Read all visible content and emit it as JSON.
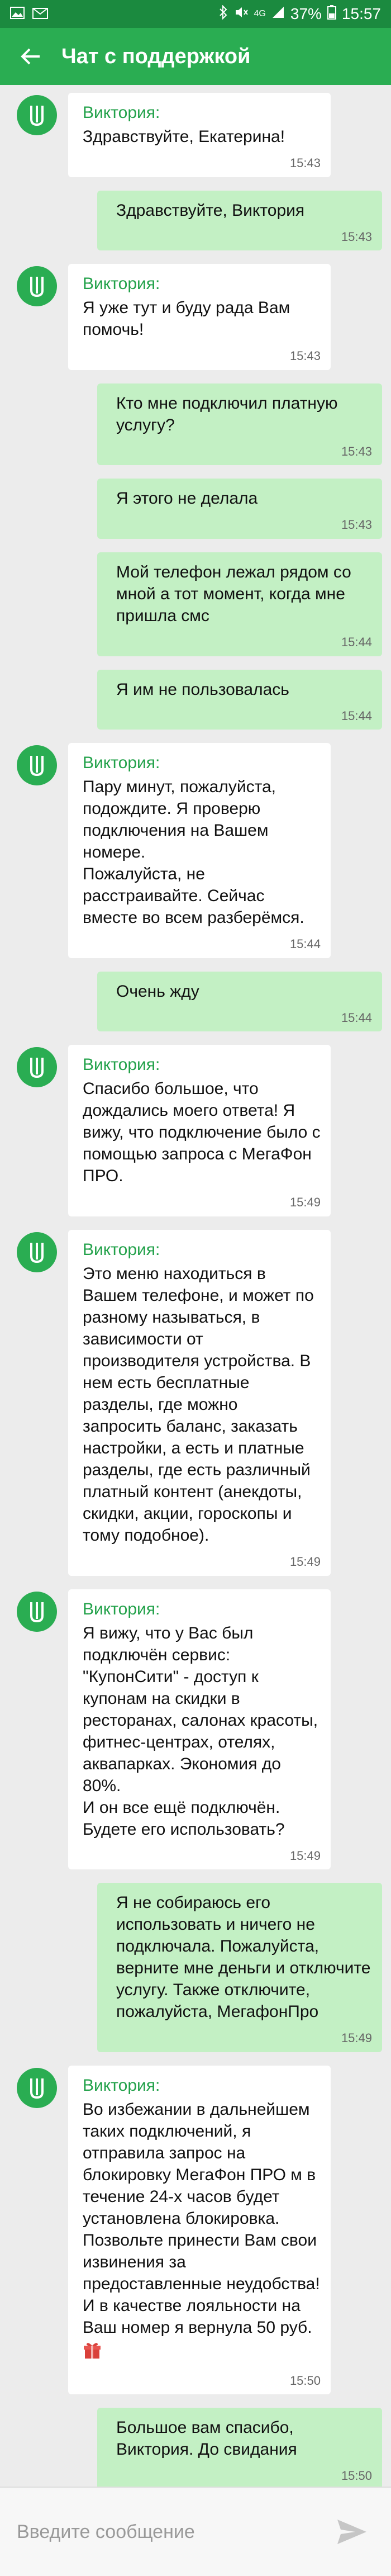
{
  "status_bar": {
    "battery": "37%",
    "network": "4G",
    "time": "15:57"
  },
  "header": {
    "title": "Чат с поддержкой"
  },
  "messages": [
    {
      "dir": "in",
      "sender": "Виктория:",
      "text": "Здравствуйте, Екатерина!",
      "time": "15:43"
    },
    {
      "dir": "out",
      "text": "Здравствуйте, Виктория",
      "time": "15:43"
    },
    {
      "dir": "in",
      "sender": "Виктория:",
      "text": "Я уже тут и буду рада Вам помочь!",
      "time": "15:43"
    },
    {
      "dir": "out",
      "text": "Кто мне подключил платную услугу?",
      "time": "15:43"
    },
    {
      "dir": "out",
      "text": "Я этого не делала",
      "time": "15:43"
    },
    {
      "dir": "out",
      "text": "Мой телефон лежал рядом со мной а тот момент, когда мне пришла смс",
      "time": "15:44"
    },
    {
      "dir": "out",
      "text": "Я им не пользовалась",
      "time": "15:44"
    },
    {
      "dir": "in",
      "sender": "Виктория:",
      "text": "Пару минут, пожалуйста, подождите. Я проверю подключения на Вашем номере.\nПожалуйста, не расстраивайте. Сейчас вместе во всем разберёмся.",
      "time": "15:44"
    },
    {
      "dir": "out",
      "text": "Очень жду",
      "time": "15:44"
    },
    {
      "dir": "in",
      "sender": "Виктория:",
      "text": "Спасибо большое, что дождались моего ответа! Я вижу, что подключение было с помощью запроса с МегаФон ПРО.",
      "time": "15:49"
    },
    {
      "dir": "in",
      "sender": "Виктория:",
      "text": "Это меню находиться в Вашем телефоне, и может по разному называться, в зависимости от производителя устройства. В нем есть бесплатные разделы, где можно запросить баланс, заказать настройки, а есть и платные разделы, где есть различный платный контент (анекдоты, скидки, акции, гороскопы и тому подобное).",
      "time": "15:49"
    },
    {
      "dir": "in",
      "sender": "Виктория:",
      "text": "Я вижу, что у Вас был подключён сервис: \"КупонСити\" - доступ к купонам на скидки в ресторанах, салонах красоты, фитнес-центрах, отелях, аквапарках. Экономия до 80%.\nИ он все ещё подключён. Будете его использовать?",
      "time": "15:49"
    },
    {
      "dir": "out",
      "text": "Я не собираюсь его использовать и ничего не подключала. Пожалуйста, верните мне деньги и отключите услугу. Также отключите, пожалуйста, МегафонПро",
      "time": "15:49"
    },
    {
      "dir": "in",
      "sender": "Виктория:",
      "text": "Во избежании в дальнейшем таких подключений, я отправила запрос на блокировку МегаФон ПРО м в течение 24-х часов будет установлена блокировка. Позвольте принести Вам свои извинения за предоставленные неудобства!\nИ в качестве лояльности на Ваш номер я вернула 50 руб.",
      "time": "15:50",
      "emoji": "gift-icon"
    },
    {
      "dir": "out",
      "text": "Большое вам спасибо, Виктория. До свидания",
      "time": "15:50"
    }
  ],
  "composer": {
    "placeholder": "Введите сообщение"
  },
  "colors": {
    "status": "#1b8a3f",
    "header": "#2aad52",
    "outgoing": "#c3f0c4",
    "incoming": "#ffffff",
    "sender": "#22a14a"
  }
}
